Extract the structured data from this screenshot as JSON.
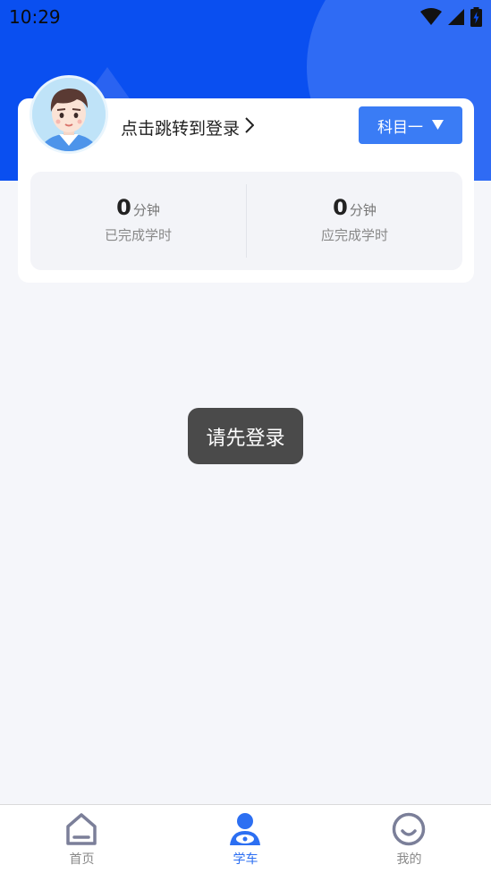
{
  "status_bar": {
    "time": "10:29"
  },
  "profile": {
    "login_prompt": "点击跳转到登录",
    "subject_selector": "科目一",
    "stats": {
      "completed": {
        "value": "0",
        "unit": "分钟",
        "label": "已完成学时"
      },
      "required": {
        "value": "0",
        "unit": "分钟",
        "label": "应完成学时"
      }
    }
  },
  "toast": {
    "message": "请先登录"
  },
  "bottom_nav": {
    "items": [
      {
        "label": "首页",
        "icon": "home-icon"
      },
      {
        "label": "学车",
        "icon": "learner-driver-icon",
        "active": true
      },
      {
        "label": "我的",
        "icon": "smile-icon"
      }
    ]
  },
  "colors": {
    "primary_blue": "#0a4ff0",
    "accent_blue": "#3a7cf5",
    "active_nav": "#2c6ff2"
  }
}
